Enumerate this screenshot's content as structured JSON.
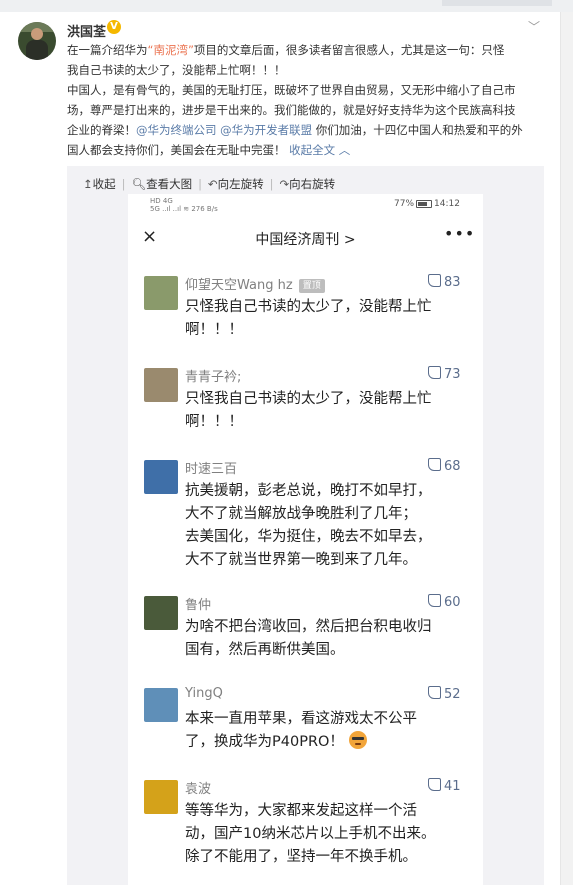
{
  "post": {
    "username": "洪国荃",
    "verified_badge": "V",
    "lines": [
      "在一篇介绍华为“南泥湾”项目的文章后面，很多读者留言很感人，尤其是这一句：只怪",
      "我自己书读的太少了，没能帮上忙啊！！！",
      "中国人，是有骨气的，美国的无耻打压，既破坏了世界自由贸易，又无形中缩小了自己市",
      "场，尊严是打出来的，进步是干出来的。我们能做的，就是好好支持华为这个民族高科技"
    ],
    "line1_pre": "在一篇介绍华为",
    "line1_link": "“南泥湾”",
    "line1_post": "项目的文章后面，很多读者留言很感人，尤其是这一句：只怪",
    "line5_pre": "企业的脊梁！",
    "mention1": "@华为终端公司",
    "mention2": "@华为开发者联盟",
    "line5_post": " 你们加油，十四亿中国人和热爱和平的外",
    "line6": "国人都会支持你们，美国会在无耻中完蛋！ ",
    "collapse_label": "收起全文 ︿"
  },
  "image_toolbar": {
    "collapse": "收起",
    "view_large": "查看大图",
    "rotate_left": "向左旋转",
    "rotate_right": "向右旋转"
  },
  "phone": {
    "status_left_top": "HD 4G",
    "status_left_bottom": "5G ..ıl ..ıl  ≋ 276 B/s",
    "battery_percent": "77%",
    "time": "14:12",
    "title": "中国经济周刊 >",
    "close_icon": "×",
    "more_icon": "•••"
  },
  "comments": [
    {
      "name": "仰望天空Wang hz",
      "pinned_label": "置顶",
      "likes": "83",
      "lines": [
        "只怪我自己书读的太少了，没能帮上忙",
        "啊！！！"
      ],
      "avatar_color": "#8a9a6b"
    },
    {
      "name": "青青子衿;",
      "pinned_label": "",
      "likes": "73",
      "lines": [
        "只怪我自己书读的太少了，没能帮上忙",
        "啊！！！"
      ],
      "avatar_color": "#9a8a6e"
    },
    {
      "name": "时速三百",
      "pinned_label": "",
      "likes": "68",
      "lines": [
        "抗美援朝，彭老总说，晚打不如早打，",
        "大不了就当解放战争晚胜利了几年；",
        "去美国化，华为挺住，晚去不如早去，",
        "大不了就当世界第一晚到来了几年。"
      ],
      "avatar_color": "#3f6fa8"
    },
    {
      "name": "鲁仲",
      "pinned_label": "",
      "likes": "60",
      "lines": [
        "为啥不把台湾收回，然后把台积电收归",
        "国有，然后再断供美国。"
      ],
      "avatar_color": "#4a5a3a"
    },
    {
      "name": "YingQ",
      "pinned_label": "",
      "likes": "52",
      "lines": [
        "本来一直用苹果，看这游戏太不公平",
        "了，换成华为P40PRO！"
      ],
      "avatar_color": "#5f8fb8"
    },
    {
      "name": "袁波",
      "pinned_label": "",
      "likes": "41",
      "lines": [
        "等等华为，大家都来发起这样一个活",
        "动，国产10纳米芯片以上手机不出来。",
        "除了不能用了，坚持一年不换手机。"
      ],
      "avatar_color": "#d4a21a"
    }
  ]
}
